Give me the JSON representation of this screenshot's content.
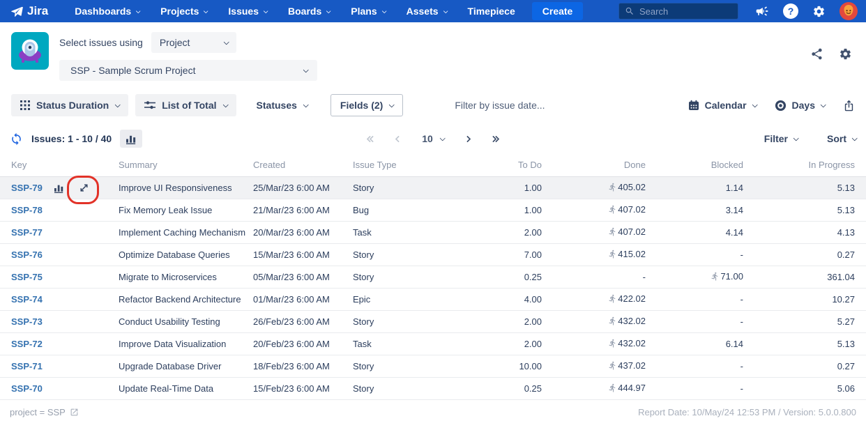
{
  "navbar": {
    "brand": "Jira",
    "items": [
      {
        "label": "Dashboards",
        "chevron": true
      },
      {
        "label": "Projects",
        "chevron": true
      },
      {
        "label": "Issues",
        "chevron": true
      },
      {
        "label": "Boards",
        "chevron": true
      },
      {
        "label": "Plans",
        "chevron": true
      },
      {
        "label": "Assets",
        "chevron": true
      },
      {
        "label": "Timepiece",
        "chevron": false
      }
    ],
    "create_label": "Create",
    "search_placeholder": "Search"
  },
  "header": {
    "select_label": "Select issues using",
    "mode_value": "Project",
    "project_value": "SSP - Sample Scrum Project"
  },
  "toolbar": {
    "report_type": "Status Duration",
    "view_mode": "List of Total",
    "statuses_label": "Statuses",
    "fields_label": "Fields (2)",
    "date_filter_placeholder": "Filter by issue date...",
    "calendar_label": "Calendar",
    "unit_label": "Days"
  },
  "issues_bar": {
    "count_text": "Issues: 1 - 10 / 40",
    "page_size": "10",
    "filter_label": "Filter",
    "sort_label": "Sort"
  },
  "table": {
    "columns": [
      "Key",
      "Summary",
      "Created",
      "Issue Type",
      "To Do",
      "Done",
      "Blocked",
      "In Progress"
    ],
    "rows": [
      {
        "key": "SSP-79",
        "summary": "Improve UI Responsiveness",
        "created": "25/Mar/23 6:00 AM",
        "issue_type": "Story",
        "to_do": "1.00",
        "done": "405.02",
        "done_running": true,
        "blocked": "1.14",
        "blocked_running": false,
        "in_progress": "5.13",
        "show_icons": true,
        "highlight": true
      },
      {
        "key": "SSP-78",
        "summary": "Fix Memory Leak Issue",
        "created": "21/Mar/23 6:00 AM",
        "issue_type": "Bug",
        "to_do": "1.00",
        "done": "407.02",
        "done_running": true,
        "blocked": "3.14",
        "blocked_running": false,
        "in_progress": "5.13",
        "show_icons": false,
        "highlight": false
      },
      {
        "key": "SSP-77",
        "summary": "Implement Caching Mechanism",
        "created": "20/Mar/23 6:00 AM",
        "issue_type": "Task",
        "to_do": "2.00",
        "done": "407.02",
        "done_running": true,
        "blocked": "4.14",
        "blocked_running": false,
        "in_progress": "4.13",
        "show_icons": false,
        "highlight": false
      },
      {
        "key": "SSP-76",
        "summary": "Optimize Database Queries",
        "created": "15/Mar/23 6:00 AM",
        "issue_type": "Story",
        "to_do": "7.00",
        "done": "415.02",
        "done_running": true,
        "blocked": "-",
        "blocked_running": false,
        "in_progress": "0.27",
        "show_icons": false,
        "highlight": false
      },
      {
        "key": "SSP-75",
        "summary": "Migrate to Microservices",
        "created": "05/Mar/23 6:00 AM",
        "issue_type": "Story",
        "to_do": "0.25",
        "done": "-",
        "done_running": false,
        "blocked": "71.00",
        "blocked_running": true,
        "in_progress": "361.04",
        "show_icons": false,
        "highlight": false
      },
      {
        "key": "SSP-74",
        "summary": "Refactor Backend Architecture",
        "created": "01/Mar/23 6:00 AM",
        "issue_type": "Epic",
        "to_do": "4.00",
        "done": "422.02",
        "done_running": true,
        "blocked": "-",
        "blocked_running": false,
        "in_progress": "10.27",
        "show_icons": false,
        "highlight": false
      },
      {
        "key": "SSP-73",
        "summary": "Conduct Usability Testing",
        "created": "26/Feb/23 6:00 AM",
        "issue_type": "Story",
        "to_do": "2.00",
        "done": "432.02",
        "done_running": true,
        "blocked": "-",
        "blocked_running": false,
        "in_progress": "5.27",
        "show_icons": false,
        "highlight": false
      },
      {
        "key": "SSP-72",
        "summary": "Improve Data Visualization",
        "created": "20/Feb/23 6:00 AM",
        "issue_type": "Task",
        "to_do": "2.00",
        "done": "432.02",
        "done_running": true,
        "blocked": "6.14",
        "blocked_running": false,
        "in_progress": "5.13",
        "show_icons": false,
        "highlight": false
      },
      {
        "key": "SSP-71",
        "summary": "Upgrade Database Driver",
        "created": "18/Feb/23 6:00 AM",
        "issue_type": "Story",
        "to_do": "10.00",
        "done": "437.02",
        "done_running": true,
        "blocked": "-",
        "blocked_running": false,
        "in_progress": "0.27",
        "show_icons": false,
        "highlight": false
      },
      {
        "key": "SSP-70",
        "summary": "Update Real-Time Data",
        "created": "15/Feb/23 6:00 AM",
        "issue_type": "Story",
        "to_do": "0.25",
        "done": "444.97",
        "done_running": true,
        "blocked": "-",
        "blocked_running": false,
        "in_progress": "5.06",
        "show_icons": false,
        "highlight": false
      }
    ]
  },
  "footer": {
    "jql_text": "project = SSP",
    "report_info": "Report Date: 10/May/24 12:53 PM / Version: 5.0.0.800"
  },
  "colors": {
    "navbar_bg": "#1759c4",
    "create_button": "#0c66e4",
    "search_bg": "#0c3b78",
    "link_blue": "#3572b0",
    "accent_navy": "#344563",
    "app_logo_teal": "#00a8c0",
    "annotation_red": "#e23228",
    "row_highlight": "#f1f2f4"
  },
  "icons": {
    "jira-logo": "paper-plane mark",
    "search": "magnifier",
    "megaphone": "announcement horn",
    "help": "?",
    "gear": "cog",
    "avatar": "orange person emoji",
    "share": "connected nodes",
    "grid": "3x3 dot grid",
    "sliders": "tune sliders",
    "calendar": "calendar grid",
    "unit-visibility": "target rings",
    "export": "box with up arrow",
    "refresh": "sync arrows",
    "bar-chart": "three bars",
    "expand": "diagonal resize arrows",
    "runner": "running man",
    "external-link": "arrow out of box"
  }
}
